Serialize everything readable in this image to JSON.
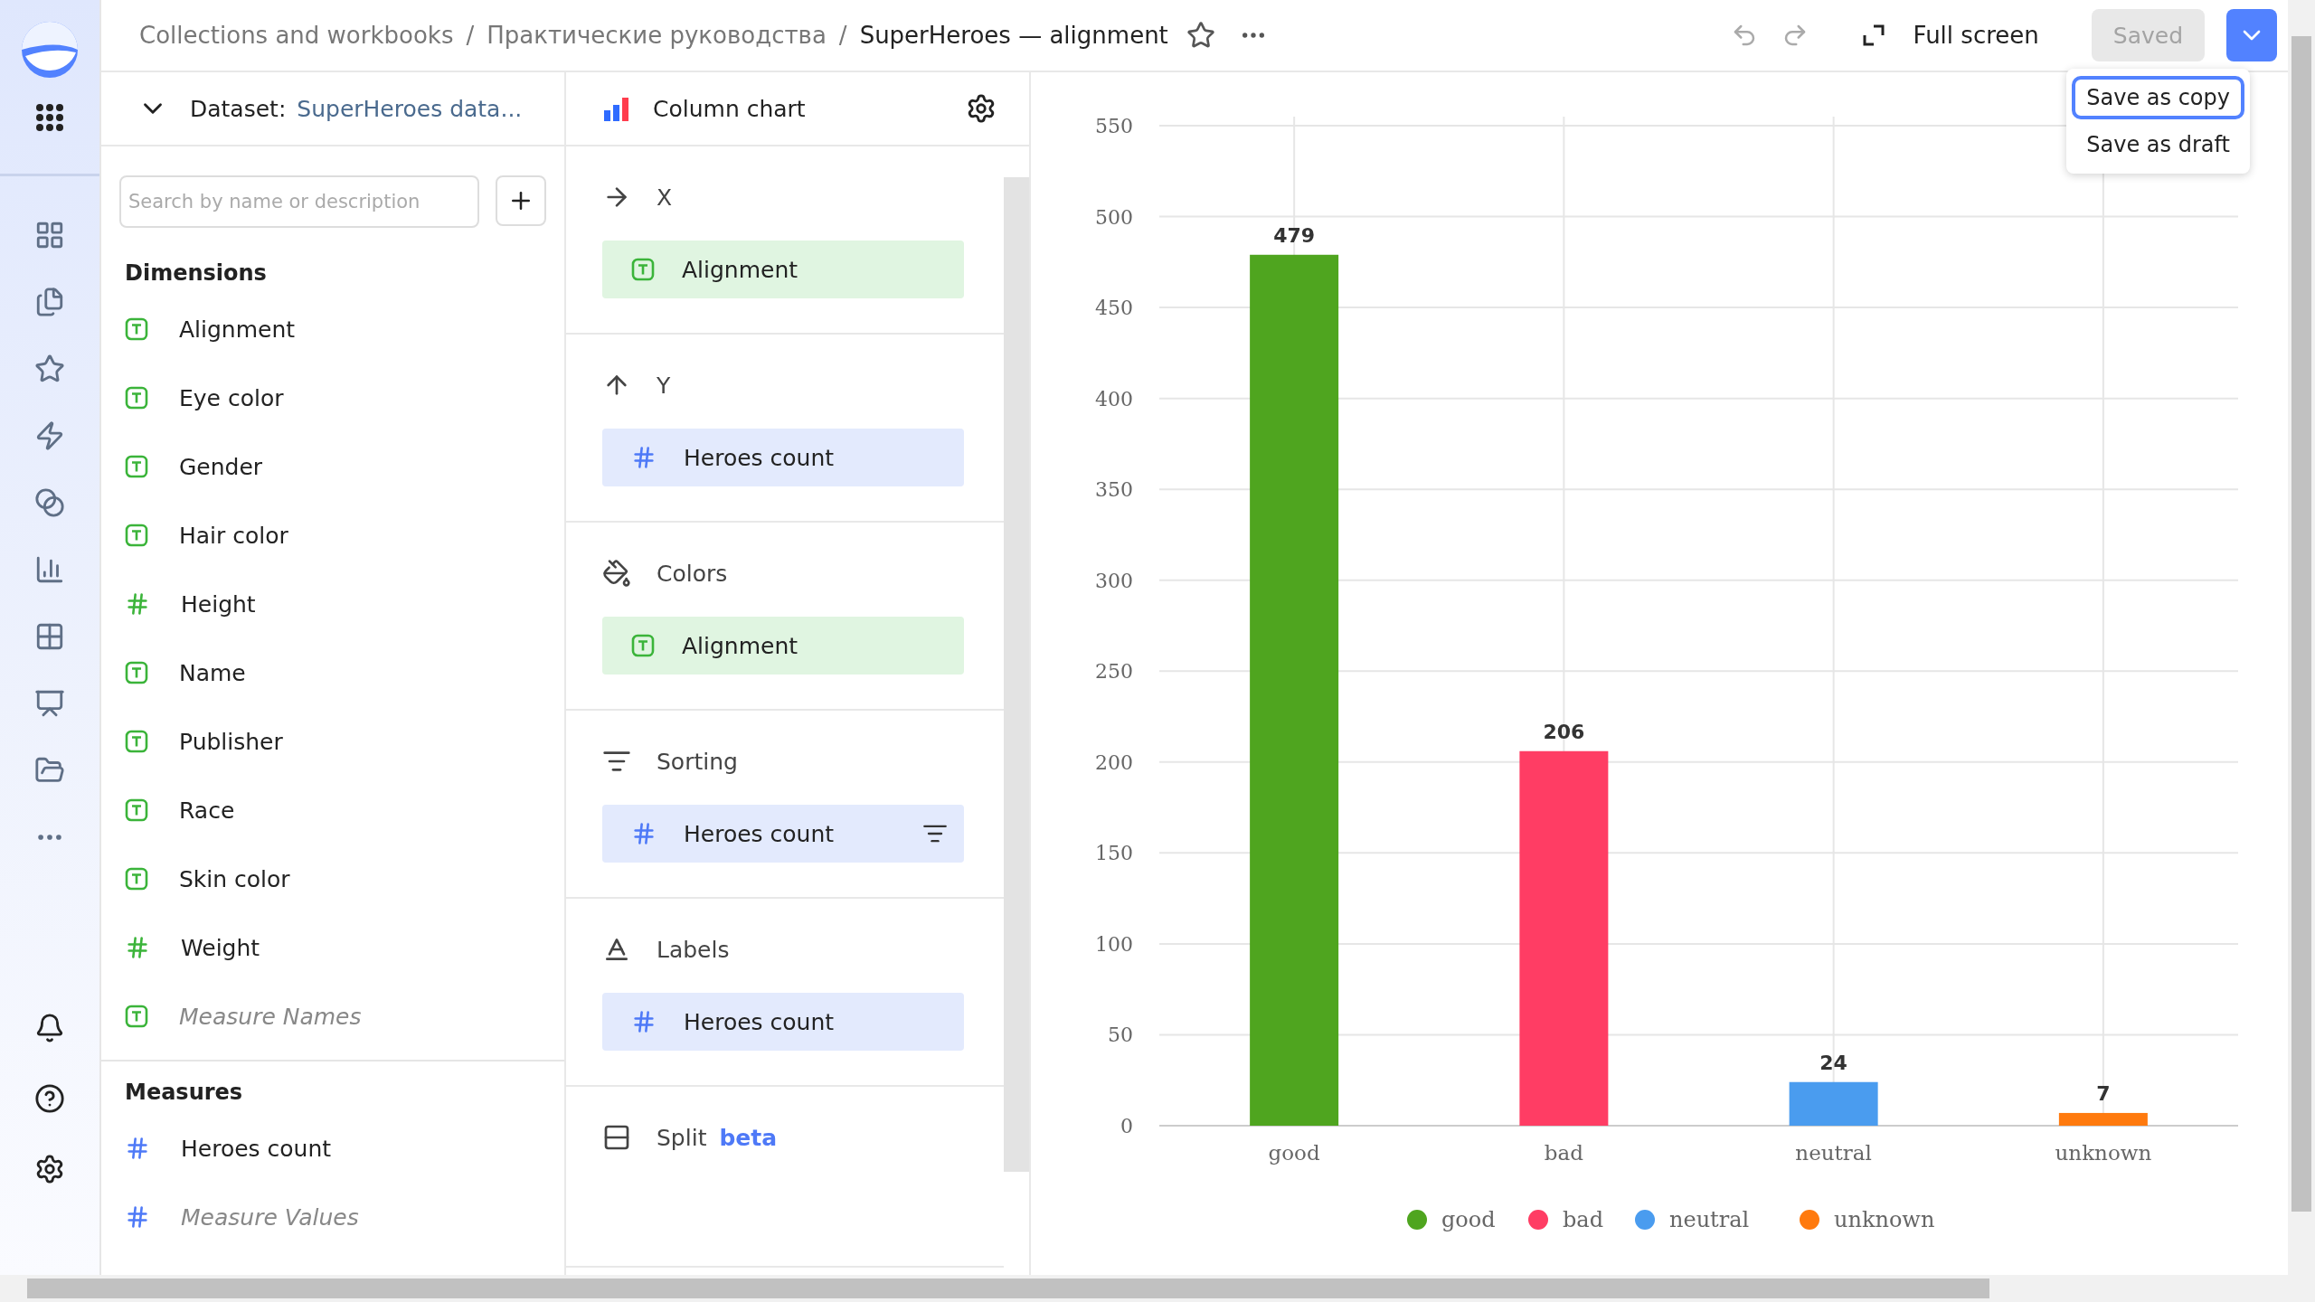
{
  "breadcrumbs": [
    {
      "label": "Collections and workbooks",
      "current": false
    },
    {
      "label": "Практические руководства",
      "current": false,
      "separator": "/"
    },
    {
      "label": "SuperHeroes — alignment",
      "current": true,
      "separator": "/"
    }
  ],
  "toolbar": {
    "fullscreen": "Full screen",
    "save": {
      "label": "Saved",
      "disabled": true
    }
  },
  "save_menu": [
    {
      "label": "Save as copy",
      "selected": true
    },
    {
      "label": "Save as draft",
      "selected": false
    }
  ],
  "dataset": {
    "label": "Dataset:",
    "name": "SuperHeroes data...",
    "search": {
      "placeholder": "Search by name or description"
    },
    "sections": [
      {
        "title": "Dimensions",
        "measure": false,
        "fields": [
          {
            "name": "Alignment",
            "kind": "text",
            "virtual": false
          },
          {
            "name": "Eye color",
            "kind": "text",
            "virtual": false
          },
          {
            "name": "Gender",
            "kind": "text",
            "virtual": false
          },
          {
            "name": "Hair color",
            "kind": "text",
            "virtual": false
          },
          {
            "name": "Height",
            "kind": "number",
            "virtual": false
          },
          {
            "name": "Name",
            "kind": "text",
            "virtual": false
          },
          {
            "name": "Publisher",
            "kind": "text",
            "virtual": false
          },
          {
            "name": "Race",
            "kind": "text",
            "virtual": false
          },
          {
            "name": "Skin color",
            "kind": "text",
            "virtual": false
          },
          {
            "name": "Weight",
            "kind": "number",
            "virtual": false
          },
          {
            "name": "Measure Names",
            "kind": "text",
            "virtual": true
          }
        ]
      },
      {
        "title": "Measures",
        "measure": true,
        "fields": [
          {
            "name": "Heroes count",
            "kind": "number",
            "virtual": false
          },
          {
            "name": "Measure Values",
            "kind": "number",
            "virtual": true
          }
        ]
      }
    ]
  },
  "visualization": {
    "type": "Column chart",
    "sections": [
      {
        "kind": "x",
        "title": "X",
        "fields": [
          {
            "name": "Alignment",
            "kind": "text",
            "measure": false
          }
        ]
      },
      {
        "kind": "y",
        "title": "Y",
        "fields": [
          {
            "name": "Heroes count",
            "kind": "number",
            "measure": true
          }
        ]
      },
      {
        "kind": "colors",
        "title": "Colors",
        "fields": [
          {
            "name": "Alignment",
            "kind": "text",
            "measure": false
          }
        ]
      },
      {
        "kind": "sort",
        "title": "Sorting",
        "fields": [
          {
            "name": "Heroes count",
            "kind": "number",
            "measure": true
          }
        ]
      },
      {
        "kind": "labels",
        "title": "Labels",
        "fields": [
          {
            "name": "Heroes count",
            "kind": "number",
            "measure": true
          }
        ]
      },
      {
        "kind": "split",
        "title": "Split",
        "badge": "beta"
      }
    ]
  },
  "chart": {
    "chart_data": {
      "type": "bar",
      "categories": [
        "good",
        "bad",
        "neutral",
        "unknown"
      ],
      "series": [
        {
          "name": "good",
          "color": "#4fa51f",
          "values": [
            479,
            null,
            null,
            null
          ]
        },
        {
          "name": "bad",
          "color": "#ff3d64",
          "values": [
            null,
            206,
            null,
            null
          ]
        },
        {
          "name": "neutral",
          "color": "#4a9cef",
          "values": [
            null,
            null,
            24,
            null
          ]
        },
        {
          "name": "unknown",
          "color": "#ff7a0e",
          "values": [
            null,
            null,
            null,
            7
          ]
        }
      ],
      "ylim": [
        0,
        550
      ],
      "yticks": [
        0,
        50,
        100,
        150,
        200,
        250,
        300,
        350,
        400,
        450,
        500,
        550
      ],
      "data_labels": true,
      "grid": true,
      "legend": true
    }
  }
}
